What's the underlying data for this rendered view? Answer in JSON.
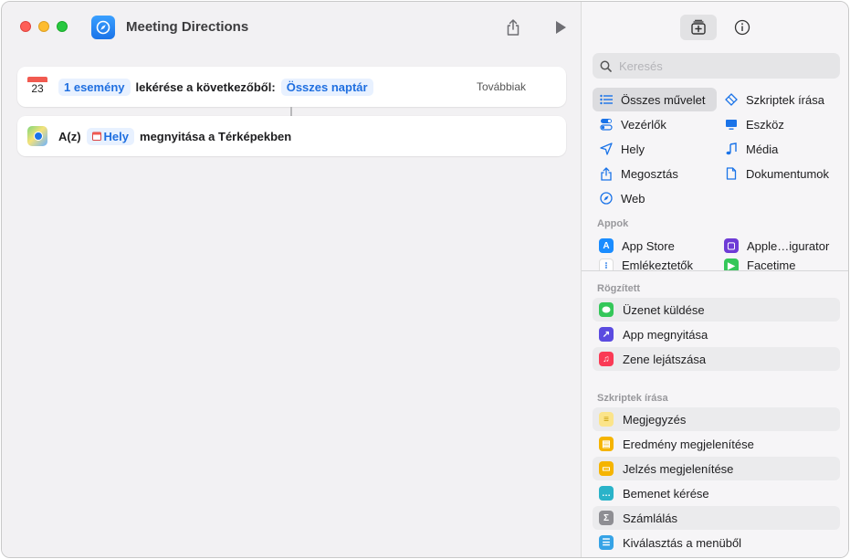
{
  "window": {
    "title": "Meeting Directions"
  },
  "actions": [
    {
      "token1": "1 esemény",
      "text1": "lekérése a következőből:",
      "token2": "Összes naptár",
      "more": "Továbbiak",
      "cal_month": "JUL",
      "cal_day": "23"
    },
    {
      "prefix": "A(z)",
      "token": "Hely",
      "text": "megnyitása a Térképekben"
    }
  ],
  "sidebar": {
    "search_placeholder": "Keresés",
    "categories_left": [
      {
        "label": "Összes művelet",
        "icon": "list-icon",
        "selected": true
      },
      {
        "label": "Vezérlők",
        "icon": "toggle-icon"
      },
      {
        "label": "Hely",
        "icon": "location-arrow-icon"
      },
      {
        "label": "Megosztás",
        "icon": "share-icon"
      },
      {
        "label": "Web",
        "icon": "compass-icon"
      }
    ],
    "categories_right": [
      {
        "label": "Szkriptek írása",
        "icon": "script-icon"
      },
      {
        "label": "Eszköz",
        "icon": "monitor-icon"
      },
      {
        "label": "Média",
        "icon": "music-note-icon"
      },
      {
        "label": "Dokumentumok",
        "icon": "document-icon"
      }
    ],
    "apps_label": "Appok",
    "apps": [
      {
        "label": "App Store",
        "color": "#1a8cff"
      },
      {
        "label": "Apple…igurator",
        "color": "#6e3bd6"
      },
      {
        "label": "Emlékeztetők",
        "color": "#ffffff"
      },
      {
        "label": "Facetime",
        "color": "#34c759"
      }
    ],
    "pinned_label": "Rögzített",
    "pinned": [
      {
        "label": "Üzenet küldése",
        "color": "#34c759"
      },
      {
        "label": "App megnyitása",
        "color": "#5b4be0"
      },
      {
        "label": "Zene lejátszása",
        "color": "#fa3a55"
      }
    ],
    "scripting_label": "Szkriptek írása",
    "scripting": [
      {
        "label": "Megjegyzés",
        "color": "#f7d046"
      },
      {
        "label": "Eredmény megjelenítése",
        "color": "#f5b400"
      },
      {
        "label": "Jelzés megjelenítése",
        "color": "#f5b400"
      },
      {
        "label": "Bemenet kérése",
        "color": "#2ab3c9"
      },
      {
        "label": "Számlálás",
        "color": "#8e8e93"
      },
      {
        "label": "Kiválasztás a menüből",
        "color": "#36a3e6"
      }
    ]
  }
}
